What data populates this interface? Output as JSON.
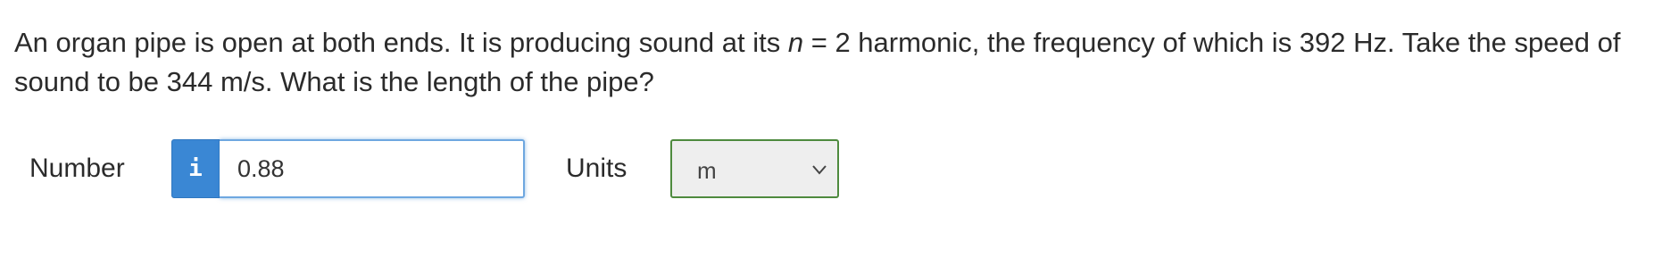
{
  "question": {
    "before": "An organ pipe is open at both ends. It is producing sound at its ",
    "variable": "n",
    "after": " = 2 harmonic, the frequency of which is 392 Hz. Take the speed of sound to be 344 m/s. What is the length of the pipe?"
  },
  "answer": {
    "number_label": "Number",
    "info_icon_glyph": "i",
    "number_value": "0.88",
    "units_label": "Units",
    "units_selected": "m"
  },
  "colors": {
    "info_button": "#3a87d4",
    "input_focus_border": "#6ea7e0",
    "select_border": "#4e8a3e",
    "select_background": "#eeeeee"
  }
}
